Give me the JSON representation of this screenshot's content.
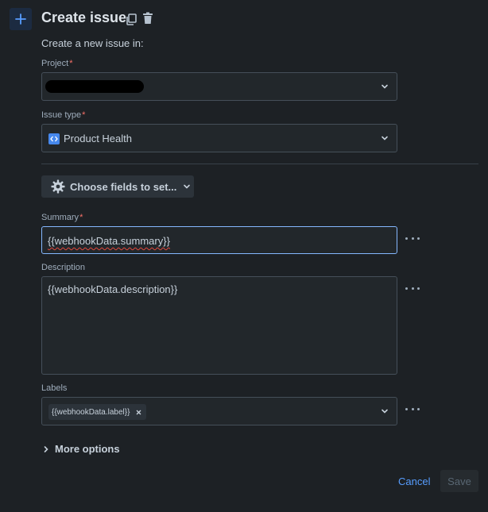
{
  "header": {
    "add_icon": "plus-icon",
    "title": "Create issue",
    "copy_icon": "copy-icon",
    "delete_icon": "trash-icon"
  },
  "subtitle": "Create a new issue in:",
  "project": {
    "label": "Project",
    "required_mark": "*",
    "value_redacted": true
  },
  "issue_type": {
    "label": "Issue type",
    "required_mark": "*",
    "value": "Product Health",
    "icon": "product-health-icon"
  },
  "choose_fields": {
    "label": "Choose fields to set...",
    "icon": "gear-icon"
  },
  "summary": {
    "label": "Summary",
    "required_mark": "*",
    "value": "{{webhookData.summary}}"
  },
  "description": {
    "label": "Description",
    "value": "{{webhookData.description}}"
  },
  "labels": {
    "label": "Labels",
    "tags": [
      "{{webhookData.label}}"
    ]
  },
  "more_options": "More options",
  "footer": {
    "cancel": "Cancel",
    "save": "Save"
  },
  "colors": {
    "background": "#1d2125",
    "accent": "#579dff",
    "required": "#f87168",
    "field_bg": "#22272b",
    "field_border": "#454f59",
    "focus_border": "#85b8ff"
  }
}
